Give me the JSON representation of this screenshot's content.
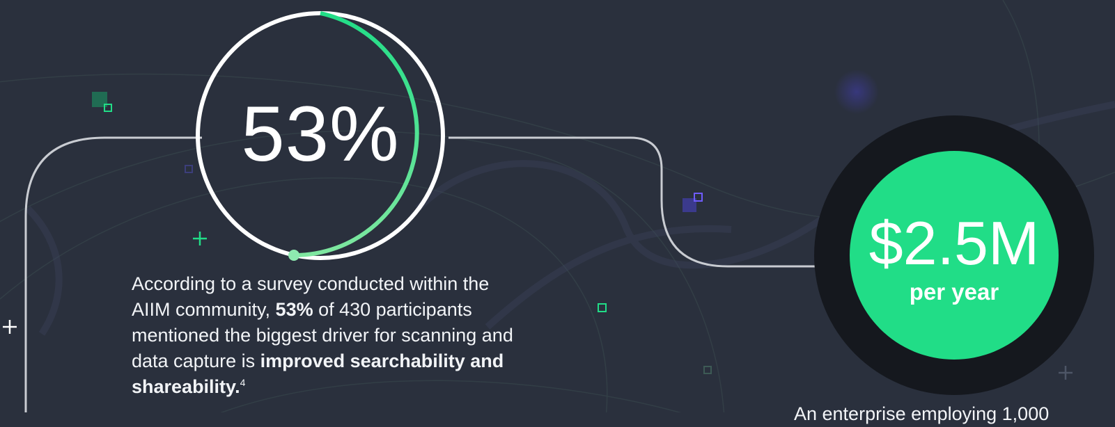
{
  "stat": {
    "value": "53%",
    "progress": 0.53,
    "body_lead": "According to a survey conducted within the AIIM community, ",
    "body_bold_1": "53%",
    "body_mid": " of 430 participants mentioned the biggest driver for scanning and data capture is ",
    "body_bold_2": "improved searchability and shareability.",
    "footnote": "4"
  },
  "cost": {
    "value": "$2.5M",
    "unit": "per year",
    "caption": "An enterprise employing 1,000"
  },
  "colors": {
    "background": "#2a303d",
    "accent_green": "#21dd87",
    "accent_purple": "#5b49d6",
    "connector": "#c9ccd2",
    "dark_ring": "#15181e"
  },
  "icons": [
    "plus-icon",
    "square-outline-icon",
    "square-filled-icon"
  ]
}
